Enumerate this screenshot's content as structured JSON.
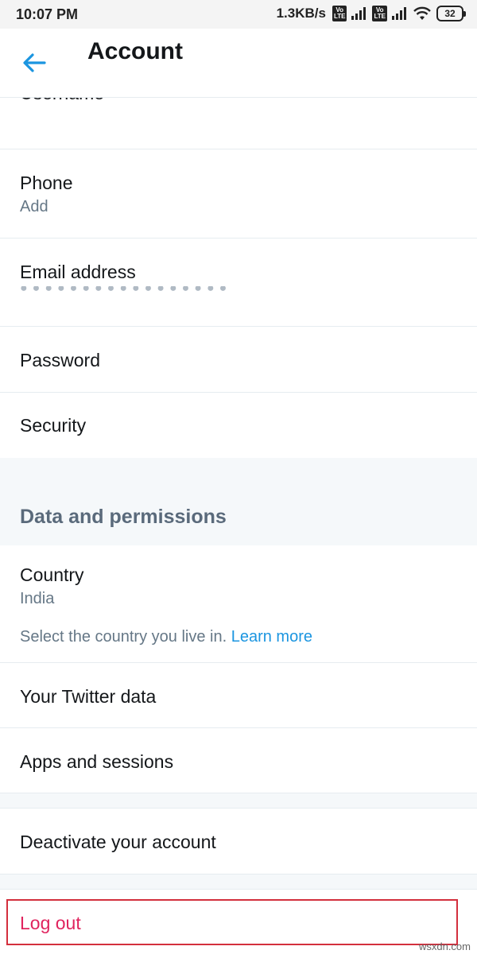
{
  "status_bar": {
    "time": "10:07 PM",
    "net_speed": "1.3KB/s",
    "battery": "32",
    "icons": [
      "volte-badge",
      "signal-icon",
      "volte-badge",
      "signal-icon",
      "wifi-icon",
      "battery-icon"
    ]
  },
  "app_bar": {
    "title": "Account",
    "back_icon": "arrow-left-icon"
  },
  "rows": {
    "username": {
      "label": "Username"
    },
    "phone": {
      "label": "Phone",
      "value": "Add"
    },
    "email": {
      "label": "Email address",
      "value": "●●●●●●●●●●●●●●●●●"
    },
    "password": {
      "label": "Password"
    },
    "security": {
      "label": "Security"
    },
    "section_data": {
      "title": "Data and permissions"
    },
    "country": {
      "label": "Country",
      "value": "India",
      "helper": "Select the country you live in.",
      "helper_link": "Learn more"
    },
    "twitter_data": {
      "label": "Your Twitter data"
    },
    "apps_sessions": {
      "label": "Apps and sessions"
    },
    "deactivate": {
      "label": "Deactivate your account"
    },
    "logout": {
      "label": "Log out"
    }
  },
  "colors": {
    "accent": "#1b95e0",
    "danger": "#e0245e",
    "highlight_box": "#d32f3d",
    "section_bg": "#f5f8fa"
  },
  "watermark": "wsxdn.com"
}
